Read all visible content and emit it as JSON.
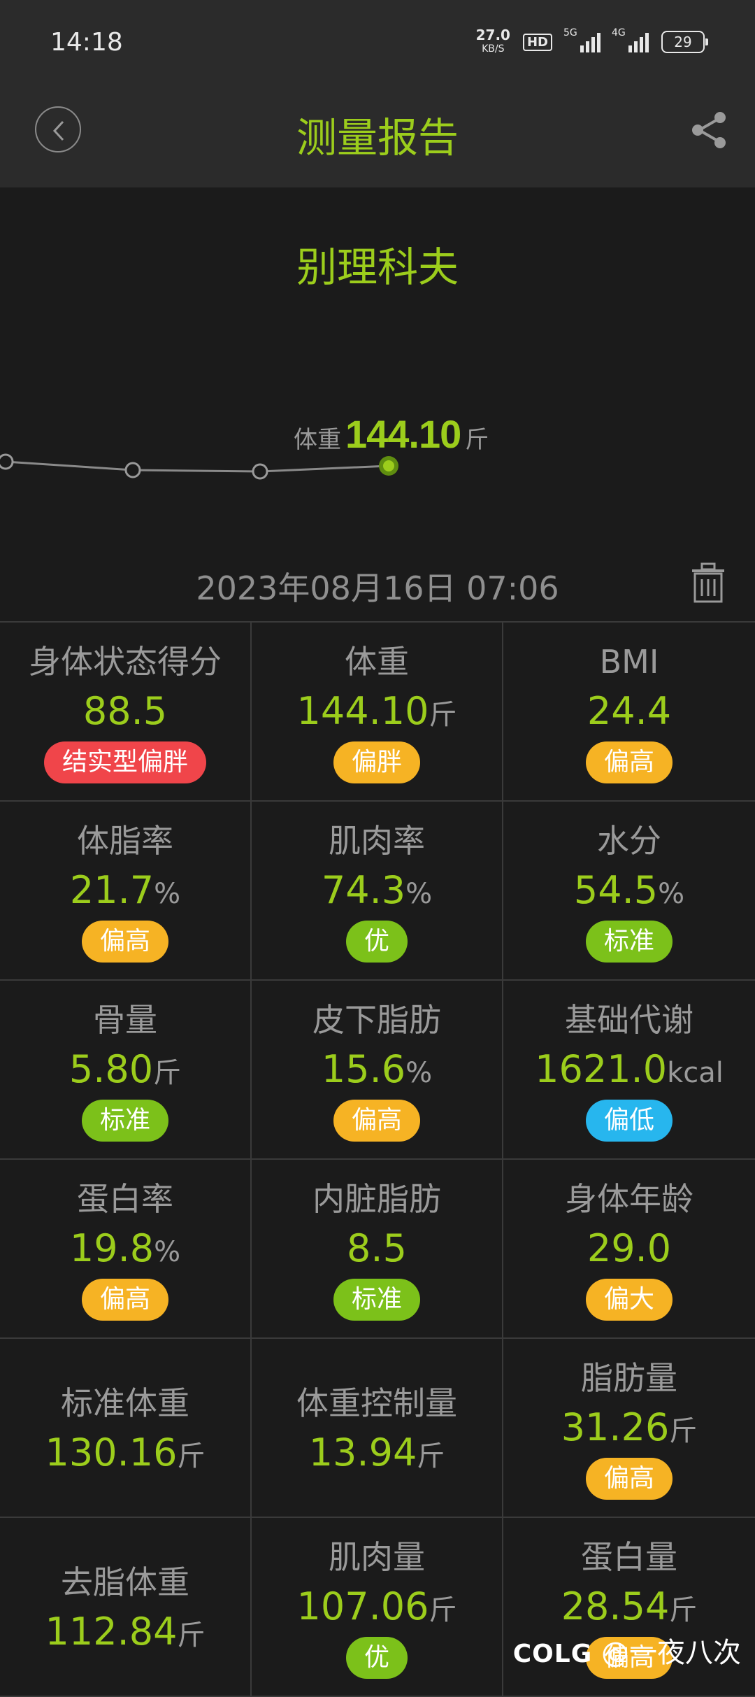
{
  "status_bar": {
    "time": "14:18",
    "net_speed": "27.0",
    "net_unit": "KB/S",
    "hd_label": "HD",
    "signal1_tag": "5G",
    "signal2_tag": "4G",
    "battery": "29"
  },
  "header": {
    "title": "测量报告",
    "back_icon": "chevron-left-icon",
    "share_icon": "share-icon"
  },
  "user": {
    "name": "别理科夫"
  },
  "weight_chart": {
    "label": "体重",
    "value": "144.10",
    "unit": "斤",
    "points_note": "trend line with 4 points, last point highlighted"
  },
  "chart_data": {
    "type": "line",
    "series": [
      {
        "values": [
          null,
          null,
          null,
          144.1
        ]
      }
    ]
  },
  "datetime": "2023年08月16日 07:06",
  "metrics": [
    {
      "label": "身体状态得分",
      "value": "88.5",
      "unit": "",
      "badge": "结实型偏胖",
      "badge_color": "#f0454a"
    },
    {
      "label": "体重",
      "value": "144.10",
      "unit": "斤",
      "badge": "偏胖",
      "badge_color": "#f6b324"
    },
    {
      "label": "BMI",
      "value": "24.4",
      "unit": "",
      "badge": "偏高",
      "badge_color": "#f6b324"
    },
    {
      "label": "体脂率",
      "value": "21.7",
      "unit": "%",
      "badge": "偏高",
      "badge_color": "#f6b324"
    },
    {
      "label": "肌肉率",
      "value": "74.3",
      "unit": "%",
      "badge": "优",
      "badge_color": "#7cc11a"
    },
    {
      "label": "水分",
      "value": "54.5",
      "unit": "%",
      "badge": "标准",
      "badge_color": "#7cc11a"
    },
    {
      "label": "骨量",
      "value": "5.80",
      "unit": "斤",
      "badge": "标准",
      "badge_color": "#7cc11a"
    },
    {
      "label": "皮下脂肪",
      "value": "15.6",
      "unit": "%",
      "badge": "偏高",
      "badge_color": "#f6b324"
    },
    {
      "label": "基础代谢",
      "value": "1621.0",
      "unit": "kcal",
      "badge": "偏低",
      "badge_color": "#27b6ee"
    },
    {
      "label": "蛋白率",
      "value": "19.8",
      "unit": "%",
      "badge": "偏高",
      "badge_color": "#f6b324"
    },
    {
      "label": "内脏脂肪",
      "value": "8.5",
      "unit": "",
      "badge": "标准",
      "badge_color": "#7cc11a"
    },
    {
      "label": "身体年龄",
      "value": "29.0",
      "unit": "",
      "badge": "偏大",
      "badge_color": "#f6b324"
    },
    {
      "label": "标准体重",
      "value": "130.16",
      "unit": "斤",
      "badge": "",
      "badge_color": ""
    },
    {
      "label": "体重控制量",
      "value": "13.94",
      "unit": "斤",
      "badge": "",
      "badge_color": ""
    },
    {
      "label": "脂肪量",
      "value": "31.26",
      "unit": "斤",
      "badge": "偏高",
      "badge_color": "#f6b324"
    },
    {
      "label": "去脂体重",
      "value": "112.84",
      "unit": "斤",
      "badge": "",
      "badge_color": ""
    },
    {
      "label": "肌肉量",
      "value": "107.06",
      "unit": "斤",
      "badge": "优",
      "badge_color": "#7cc11a"
    },
    {
      "label": "蛋白量",
      "value": "28.54",
      "unit": "斤",
      "badge": "偏高",
      "badge_color": "#f6b324"
    }
  ],
  "watermark": {
    "brand": "COLG",
    "handle": "@一夜八次"
  },
  "colors": {
    "accent": "#9ccd1c",
    "background": "#1b1b1b",
    "header": "#2b2b2b"
  }
}
